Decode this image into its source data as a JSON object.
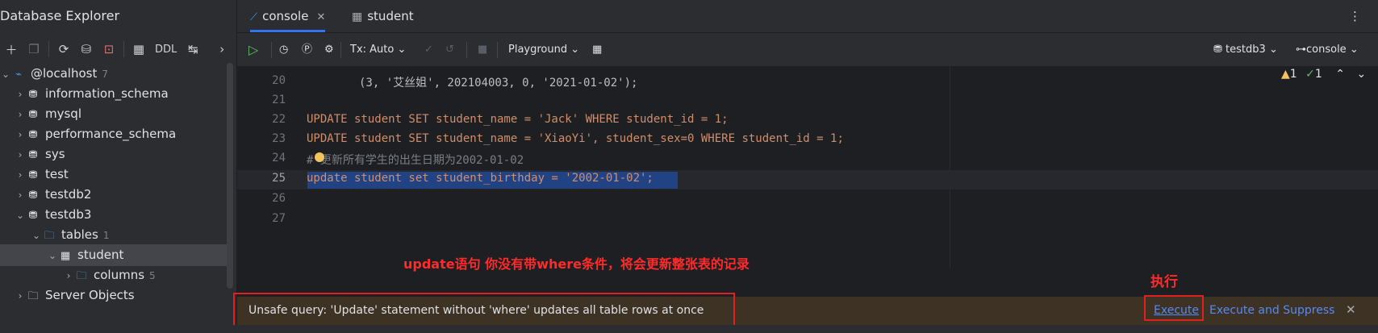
{
  "sidebar": {
    "title": "Database Explorer",
    "toolbar": {
      "ddl_label": "DDL"
    },
    "tree": [
      {
        "label": "@localhost",
        "count": "7",
        "icon": "datasource-icon"
      },
      {
        "label": "information_schema",
        "icon": "schema-icon"
      },
      {
        "label": "mysql",
        "icon": "schema-icon"
      },
      {
        "label": "performance_schema",
        "icon": "schema-icon"
      },
      {
        "label": "sys",
        "icon": "schema-icon"
      },
      {
        "label": "test",
        "icon": "schema-icon"
      },
      {
        "label": "testdb2",
        "icon": "schema-icon"
      },
      {
        "label": "testdb3",
        "icon": "schema-icon"
      },
      {
        "label": "tables",
        "count": "1",
        "icon": "folder-icon"
      },
      {
        "label": "student",
        "icon": "table-icon"
      },
      {
        "label": "columns",
        "count": "5",
        "icon": "folder-icon"
      },
      {
        "label": "Server Objects",
        "icon": "folder-icon"
      }
    ]
  },
  "tabs": [
    {
      "label": "console",
      "icon": "console-icon"
    },
    {
      "label": "student",
      "icon": "table-icon"
    }
  ],
  "editor_toolbar": {
    "tx_mode": "Tx: Auto",
    "playground": "Playground",
    "datasource": "testdb3",
    "session": "console"
  },
  "inspections": {
    "warnings": "1",
    "ok": "1"
  },
  "code_lines": [
    {
      "num": "20",
      "text": "(3, '艾丝姐', 202104003, 0, '2021-01-02');"
    },
    {
      "num": "21",
      "text": ""
    },
    {
      "num": "22",
      "text": "UPDATE student SET student_name = 'Jack' WHERE student_id = 1;"
    },
    {
      "num": "23",
      "text": "UPDATE student SET student_name = 'XiaoYi', student_sex=0 WHERE student_id = 1;"
    },
    {
      "num": "24",
      "text": "# 更新所有学生的出生日期为2002-01-02"
    },
    {
      "num": "25",
      "text": "update student set student_birthday = '2002-01-02';"
    },
    {
      "num": "26",
      "text": ""
    },
    {
      "num": "27",
      "text": ""
    }
  ],
  "annotations": {
    "main": "update语句 你没有带where条件，将会更新整张表的记录",
    "execute": "执行"
  },
  "warning_bar": {
    "message": "Unsafe query: 'Update' statement without 'where' updates all table rows at once",
    "execute_label": "Execute",
    "execute_suppress_label": "Execute and Suppress"
  }
}
